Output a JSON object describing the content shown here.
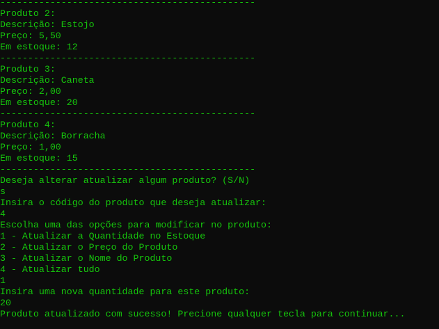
{
  "terminal": {
    "text_color": "#16c60c",
    "background_color": "#0c0c0c",
    "lines": [
      "----------------------------------------------",
      "Produto 2:",
      "Descrição: Estojo",
      "Preço: 5,50",
      "Em estoque: 12",
      "----------------------------------------------",
      "Produto 3:",
      "Descrição: Caneta",
      "Preço: 2,00",
      "Em estoque: 20",
      "----------------------------------------------",
      "Produto 4:",
      "Descrição: Borracha",
      "Preço: 1,00",
      "Em estoque: 15",
      "----------------------------------------------",
      "Deseja alterar atualizar algum produto? (S/N)",
      "s",
      "Insira o código do produto que deseja atualizar:",
      "4",
      "Escolha uma das opções para modificar no produto:",
      "1 - Atualizar a Quantidade no Estoque",
      "2 - Atualizar o Preço do Produto",
      "3 - Atualizar o Nome do Produto",
      "4 - Atualizar tudo",
      "1",
      "Insira uma nova quantidade para este produto:",
      "20",
      "Produto atualizado com sucesso! Precione qualquer tecla para continuar..."
    ]
  }
}
